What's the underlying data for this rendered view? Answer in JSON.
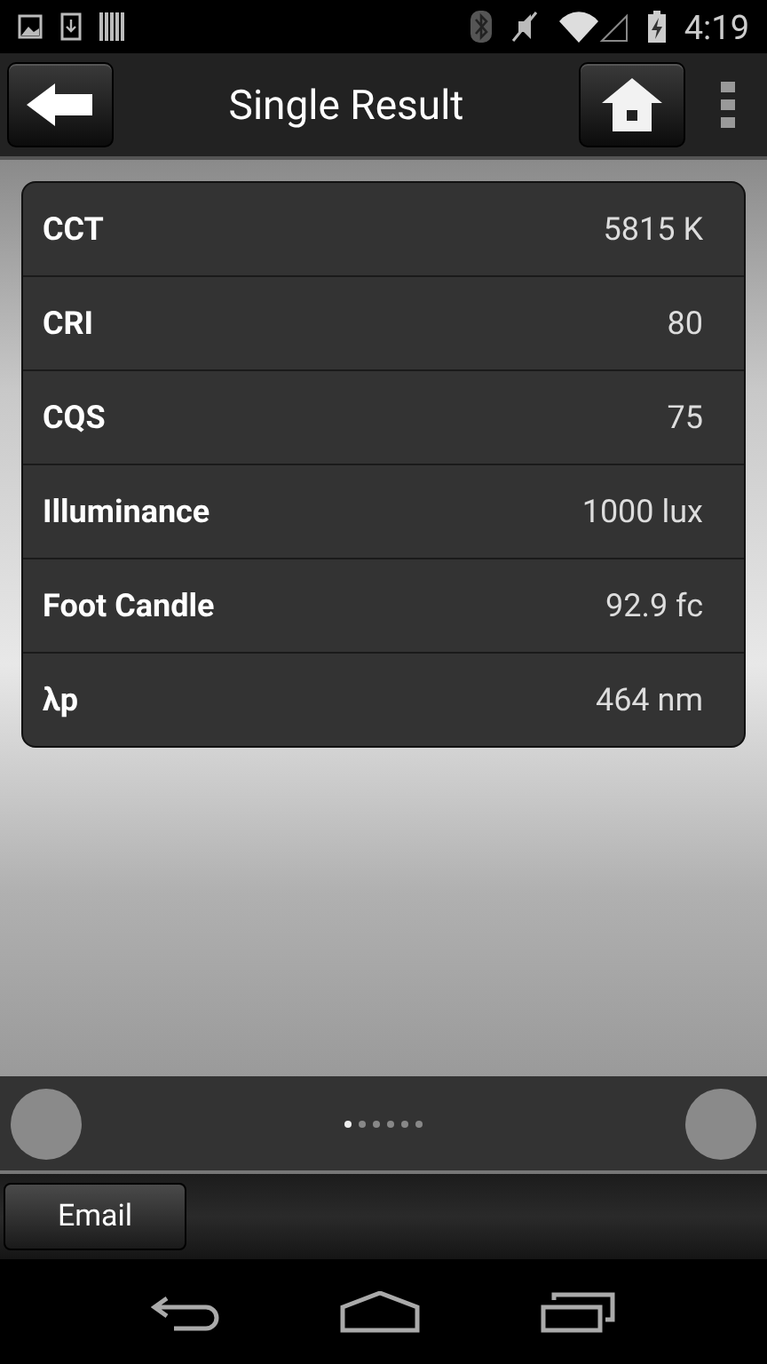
{
  "status_bar": {
    "time": "4:19"
  },
  "app_bar": {
    "title": "Single Result"
  },
  "results": [
    {
      "label": "CCT",
      "value": "5815 K"
    },
    {
      "label": "CRI",
      "value": "80"
    },
    {
      "label": "CQS",
      "value": "75"
    },
    {
      "label": "Illuminance",
      "value": "1000 lux"
    },
    {
      "label": "Foot Candle",
      "value": "92.9 fc"
    },
    {
      "label": "λp",
      "value": "464 nm"
    }
  ],
  "pager": [
    {
      "selected": true
    },
    {
      "selected": false
    },
    {
      "selected": false
    },
    {
      "selected": false
    },
    {
      "selected": false
    },
    {
      "selected": false
    }
  ],
  "buttons": [
    "Email"
  ]
}
